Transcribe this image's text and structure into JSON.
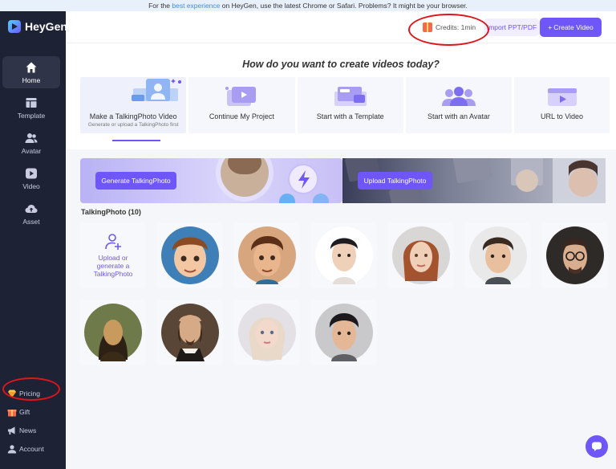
{
  "banner": {
    "prefix": "For the ",
    "highlight": "best experience",
    "suffix": " on HeyGen, use the latest Chrome or Safari. Problems? It might be your browser."
  },
  "app": {
    "name": "HeyGen"
  },
  "sidebar": {
    "items": [
      {
        "label": "Home",
        "icon": "home-icon",
        "active": true
      },
      {
        "label": "Template",
        "icon": "template-icon"
      },
      {
        "label": "Avatar",
        "icon": "avatar-icon"
      },
      {
        "label": "Video",
        "icon": "video-icon"
      },
      {
        "label": "Asset",
        "icon": "cloud-icon"
      }
    ],
    "bottom": [
      {
        "label": "Pricing",
        "icon": "diamond-icon"
      },
      {
        "label": "Gift",
        "icon": "gift-icon"
      },
      {
        "label": "News",
        "icon": "megaphone-icon"
      },
      {
        "label": "Account",
        "icon": "user-icon"
      }
    ]
  },
  "topbar": {
    "credits": "Credits: 1min",
    "import_label": "Import PPT/PDF",
    "create_label": "Create Video"
  },
  "main": {
    "heading": "How do you want to create videos today?",
    "options": [
      {
        "label": "Make a TalkingPhoto Video",
        "sub": "Generate or upload a TalkingPhoto first",
        "active": true
      },
      {
        "label": "Continue My Project"
      },
      {
        "label": "Start with a Template"
      },
      {
        "label": "Start with an Avatar"
      },
      {
        "label": "URL to Video"
      }
    ],
    "generate_label": "Generate TalkingPhoto",
    "upload_banner_label": "Upload TalkingPhoto",
    "talkingphoto_title": "TalkingPhoto (10)",
    "upload_card_text": "Upload or generate a TalkingPhoto"
  },
  "colors": {
    "accent": "#6e56f8",
    "sidebar": "#1e2235",
    "highlight_oval": "#e0141b"
  }
}
